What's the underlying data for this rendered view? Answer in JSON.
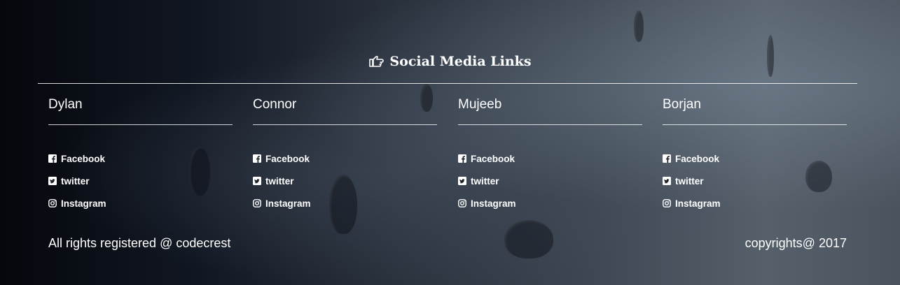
{
  "heading": {
    "icon": "hand-pointing-icon",
    "title": "Social Media Links"
  },
  "members": [
    {
      "name": "Dylan",
      "links": [
        {
          "label": "Facebook",
          "icon": "facebook-icon"
        },
        {
          "label": "twitter",
          "icon": "twitter-icon"
        },
        {
          "label": "Instagram",
          "icon": "instagram-icon"
        }
      ]
    },
    {
      "name": "Connor",
      "links": [
        {
          "label": "Facebook",
          "icon": "facebook-icon"
        },
        {
          "label": "twitter",
          "icon": "twitter-icon"
        },
        {
          "label": "Instagram",
          "icon": "instagram-icon"
        }
      ]
    },
    {
      "name": "Mujeeb",
      "links": [
        {
          "label": "Facebook",
          "icon": "facebook-icon"
        },
        {
          "label": "twitter",
          "icon": "twitter-icon"
        },
        {
          "label": "Instagram",
          "icon": "instagram-icon"
        }
      ]
    },
    {
      "name": "Borjan",
      "links": [
        {
          "label": "Facebook",
          "icon": "facebook-icon"
        },
        {
          "label": "twitter",
          "icon": "twitter-icon"
        },
        {
          "label": "Instagram",
          "icon": "instagram-icon"
        }
      ]
    }
  ],
  "footer": {
    "left": "All rights registered @ codecrest",
    "right": "copyrights@ 2017"
  },
  "colors": {
    "text": "#ffffff",
    "background_dark": "#05070c",
    "background_light": "#56606b"
  }
}
